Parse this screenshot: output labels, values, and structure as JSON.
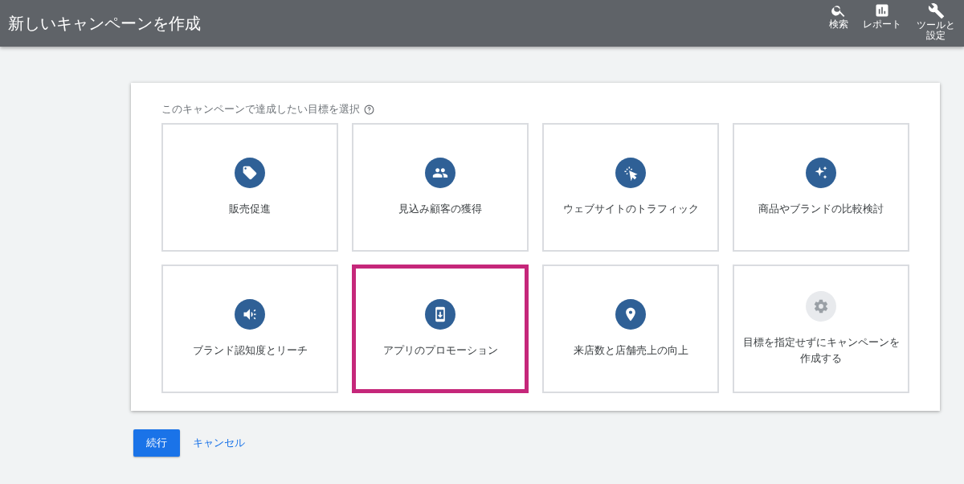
{
  "header": {
    "title": "新しいキャンペーンを作成",
    "actions": [
      {
        "kind": "search",
        "label": "検索"
      },
      {
        "kind": "report",
        "label": "レポート"
      },
      {
        "kind": "tools",
        "label": "ツールと設定"
      }
    ]
  },
  "goal_panel": {
    "prompt": "このキャンペーンで達成したい目標を選択",
    "goals": [
      {
        "kind": "sales",
        "label": "販売促進",
        "selected": false
      },
      {
        "kind": "leads",
        "label": "見込み顧客の獲得",
        "selected": false
      },
      {
        "kind": "traffic",
        "label": "ウェブサイトのトラフィック",
        "selected": false
      },
      {
        "kind": "consideration",
        "label": "商品やブランドの比較検討",
        "selected": false
      },
      {
        "kind": "awareness",
        "label": "ブランド認知度とリーチ",
        "selected": false
      },
      {
        "kind": "app",
        "label": "アプリのプロモーション",
        "selected": true
      },
      {
        "kind": "store",
        "label": "来店数と店舗売上の向上",
        "selected": false
      },
      {
        "kind": "none",
        "label": "目標を指定せずにキャンペーンを作成する",
        "selected": false
      }
    ]
  },
  "buttons": {
    "continue": "続行",
    "cancel": "キャンセル"
  }
}
